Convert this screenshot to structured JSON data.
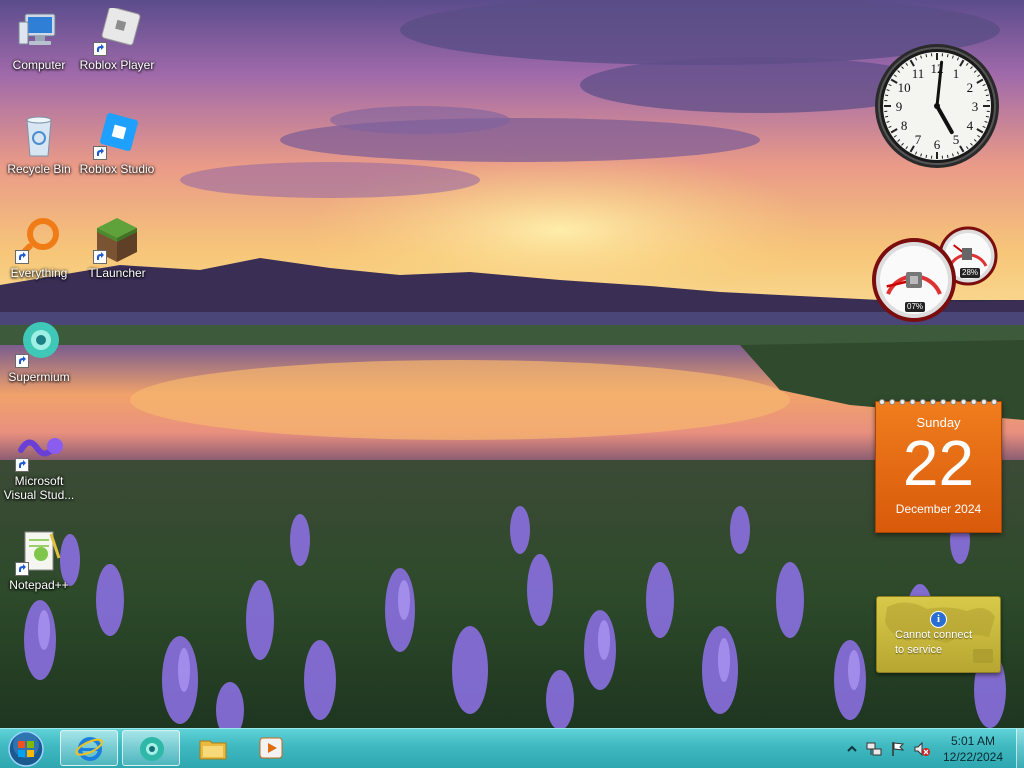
{
  "desktop_icons": [
    {
      "label": "Computer",
      "icon": "computer-icon"
    },
    {
      "label": "Roblox Player",
      "icon": "roblox-player-icon"
    },
    {
      "label": "Recycle Bin",
      "icon": "recycle-bin-icon"
    },
    {
      "label": "Roblox Studio",
      "icon": "roblox-studio-icon"
    },
    {
      "label": "Everything",
      "icon": "everything-search-icon"
    },
    {
      "label": "TLauncher",
      "icon": "tlauncher-grass-block-icon"
    },
    {
      "label": "Supermium",
      "icon": "supermium-browser-icon"
    },
    {
      "label": "Microsoft\nVisual Stud...",
      "icon": "visual-studio-icon"
    },
    {
      "label": "Notepad++",
      "icon": "notepadpp-icon"
    }
  ],
  "gadgets": {
    "clock": {
      "hour": 5,
      "minute": 1,
      "numbers": [
        "12",
        "1",
        "2",
        "3",
        "4",
        "5",
        "6",
        "7",
        "8",
        "9",
        "10",
        "11"
      ]
    },
    "cpu_meter": {
      "cpu": "07%",
      "memory": "28%",
      "cpu_value": 7,
      "memory_value": 28
    },
    "calendar": {
      "weekday": "Sunday",
      "day": "22",
      "month_year": "December 2024"
    },
    "weather": {
      "message_line1": "Cannot connect",
      "message_line2": "to service",
      "info_icon": "i"
    }
  },
  "taskbar": {
    "start_icon": "windows-start-orb-icon",
    "items": [
      {
        "icon": "internet-explorer-icon",
        "pinned": true
      },
      {
        "icon": "supermium-browser-icon",
        "pinned": true
      },
      {
        "icon": "windows-explorer-folder-icon",
        "pinned": false
      },
      {
        "icon": "media-player-icon",
        "pinned": false
      }
    ],
    "tray": {
      "icons": [
        "show-hidden-icons-chevron",
        "network-icon",
        "action-center-flag-icon",
        "volume-muted-icon"
      ],
      "time": "5:01 AM",
      "date": "12/22/2024"
    }
  },
  "colors": {
    "taskbar": "#3fb8c0",
    "calendar": "#e86a12",
    "weather": "#c9b93d"
  }
}
